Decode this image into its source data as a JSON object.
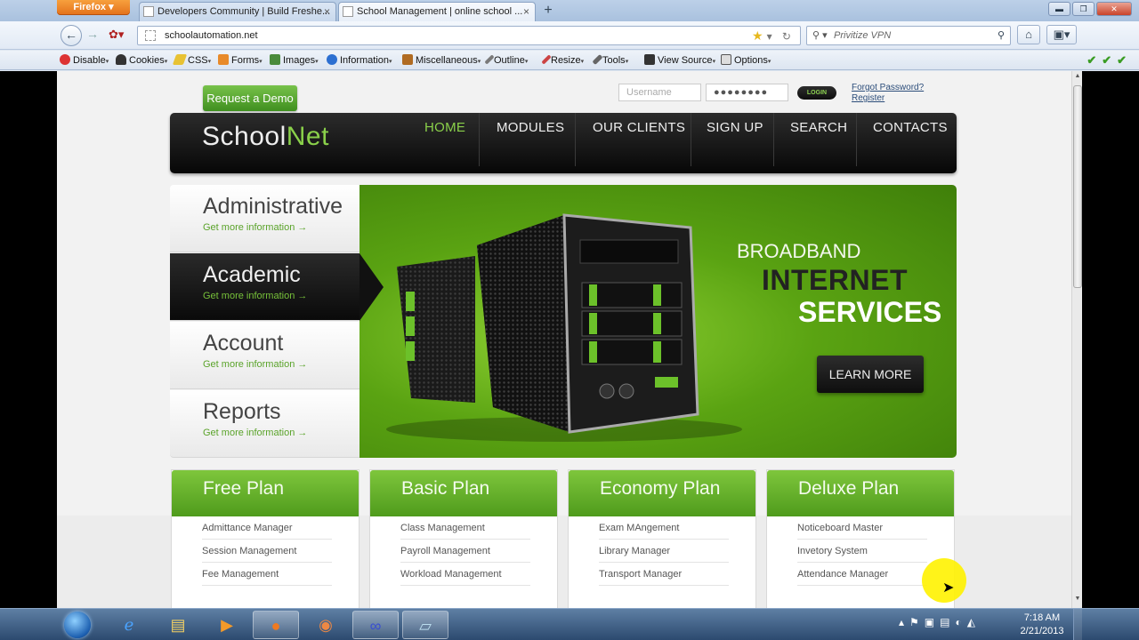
{
  "browser": {
    "app_button": "Firefox",
    "tabs": [
      {
        "label": "Developers Community | Build Freshe..."
      },
      {
        "label": "School Management | online school ..."
      }
    ],
    "url": "schoolautomation.net",
    "search_placeholder": "Privitize VPN"
  },
  "devbar": {
    "items": [
      "Disable",
      "Cookies",
      "CSS",
      "Forms",
      "Images",
      "Information",
      "Miscellaneous",
      "Outline",
      "Resize",
      "Tools",
      "View Source",
      "Options"
    ]
  },
  "page": {
    "demo_button": "Request a Demo",
    "login": {
      "username_placeholder": "Username",
      "password_mask": "●●●●●●●●",
      "button": "LOGIN",
      "forgot": "Forgot Password?",
      "register": "Register"
    },
    "logo": {
      "part1": "School",
      "part2": "Net"
    },
    "menu": [
      "HOME",
      "MODULES",
      "OUR CLIENTS",
      "SIGN UP",
      "SEARCH",
      "CONTACTS"
    ],
    "side": [
      {
        "title": "Administrative",
        "sub": "Get more information  →"
      },
      {
        "title": "Academic",
        "sub": "Get more information  →"
      },
      {
        "title": "Account",
        "sub": "Get more information  →"
      },
      {
        "title": "Reports",
        "sub": "Get more information  →"
      }
    ],
    "banner": {
      "line1": "BROADBAND",
      "line2": "INTERNET",
      "line3": "SERVICES",
      "button": "LEARN MORE"
    },
    "plans": [
      {
        "title": "Free Plan",
        "items": [
          "Admittance Manager",
          "Session Management",
          "Fee Management"
        ]
      },
      {
        "title": "Basic Plan",
        "items": [
          "Class Management",
          "Payroll Management",
          "Workload Management"
        ]
      },
      {
        "title": "Economy Plan",
        "items": [
          "Exam MAngement",
          "Library Manager",
          "Transport Manager"
        ]
      },
      {
        "title": "Deluxe Plan",
        "items": [
          "Noticeboard Master",
          "Invetory System",
          "Attendance Manager"
        ]
      }
    ]
  },
  "taskbar": {
    "time": "7:18 AM",
    "date": "2/21/2013"
  },
  "colors": {
    "accent_green": "#5aa312",
    "header_dark": "#111111",
    "firefox_orange": "#e3701a"
  }
}
